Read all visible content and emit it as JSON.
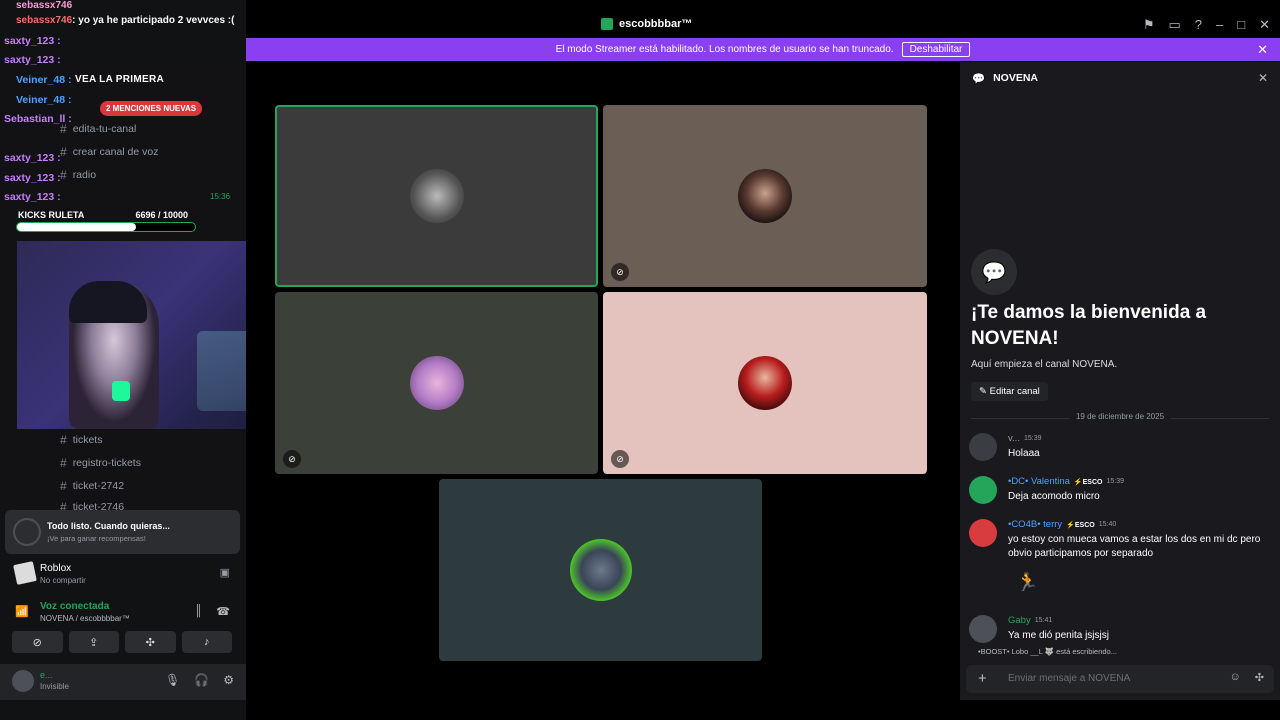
{
  "window": {
    "app_title": "escobbbbar™",
    "icons": [
      "pin-icon",
      "inbox-icon",
      "help-icon",
      "minimize-icon",
      "maximize-icon",
      "close-icon"
    ]
  },
  "banner": {
    "text": "El modo Streamer está habilitado. Los nombres de usuario se han truncado.",
    "button": "Deshabilitar"
  },
  "stream_overlay": {
    "chat": [
      {
        "user": "sebassx746",
        "text": ": yo ya he participado 2 vevvces :(",
        "color": "#ff6b6b"
      },
      {
        "user": "saxty_123 :",
        "text": "",
        "color": "#c77dff"
      },
      {
        "user": "saxty_123 :",
        "text": "",
        "color": "#c77dff"
      },
      {
        "user": "Veiner_48 :",
        "text": "",
        "color": "#4aa3ff"
      },
      {
        "user": "Veiner_48 :",
        "text": "",
        "color": "#4aa3ff"
      },
      {
        "user": "Sebastian_ll :",
        "text": "",
        "color": "#c77dff"
      },
      {
        "user": "saxty_123 :",
        "text": "",
        "color": "#c77dff"
      },
      {
        "user": "saxty_123 :",
        "text": "",
        "color": "#c77dff"
      },
      {
        "user": "saxty_123 :",
        "text": "",
        "color": "#c77dff"
      }
    ],
    "progress_label": "KICKS RULETA",
    "progress_value": "6696 / 10000",
    "progress_fraction": 0.67,
    "time": "15:36"
  },
  "sidebar": {
    "section_header": "VEA LA PRIMERA",
    "mentions_pill": "2 MENCIONES NUEVAS",
    "channels": [
      {
        "label": "edita-tu-canal"
      },
      {
        "label": "crear canal de voz"
      },
      {
        "label": "radio"
      },
      {
        "label": "tickets"
      },
      {
        "label": "registro-tickets"
      },
      {
        "label": "ticket-2742"
      },
      {
        "label": "ticket-2746"
      }
    ],
    "activity_title": "Todo listo. Cuando quieras...",
    "activity_sub": "¡Ve para ganar recompensas!",
    "game_name": "Roblox",
    "game_status": "No compartir",
    "voice_status": "Voz conectada",
    "voice_channel": "NOVENA / escobbbbar™",
    "user_name": "e...",
    "user_status": "Invisible"
  },
  "video_tiles": [
    {
      "name": "tile-dog",
      "bg": "#3b3b3b",
      "highlight": true,
      "muted": false,
      "avatar_color": "#888"
    },
    {
      "name": "tile-girl",
      "bg": "#6b5e55",
      "highlight": false,
      "muted": true,
      "avatar_color": "#3a2624"
    },
    {
      "name": "tile-purple",
      "bg": "#3b4038",
      "highlight": false,
      "muted": true,
      "avatar_color": "#b57ec8"
    },
    {
      "name": "tile-red",
      "bg": "#e4c3be",
      "highlight": false,
      "muted": true,
      "avatar_color": "#b81d1d"
    },
    {
      "name": "tile-green",
      "bg": "#2e3b3e",
      "highlight": false,
      "muted": false,
      "avatar_color": "#4cc32b"
    }
  ],
  "chat": {
    "channel_name": "NOVENA",
    "welcome_title": "¡Te damos la bienvenida a NOVENA!",
    "welcome_sub": "Aquí empieza el canal NOVENA.",
    "edit_button": "Editar canal",
    "date_divider": "19 de diciembre de 2025",
    "messages": [
      {
        "name": "v...",
        "name_color": "#949ba4",
        "tag": "",
        "time": "15:39",
        "text": "Holaaa",
        "avatar": "#3a3d44"
      },
      {
        "name": "•DC• Valentina",
        "name_color": "#4aa3ff",
        "tag": "⚡ESCO",
        "time": "15:39",
        "text": "Deja acomodo micro",
        "avatar": "#23a55a"
      },
      {
        "name": "•CO4B• terry",
        "name_color": "#4aa3ff",
        "tag": "⚡ESCO",
        "time": "15:40",
        "text": "yo estoy con mueca vamos a estar los dos en mi dc pero obvio participamos por separado",
        "avatar": "#d83c3e"
      },
      {
        "name": "Gaby",
        "name_color": "#23a55a",
        "tag": "",
        "time": "15:41",
        "text": "Ya me dió penita jsjsjsj",
        "avatar": "#4e5058"
      }
    ],
    "typing": "•BOOST• Lobo __L 🐺 está escribiendo...",
    "placeholder": "Enviar mensaje a NOVENA"
  }
}
